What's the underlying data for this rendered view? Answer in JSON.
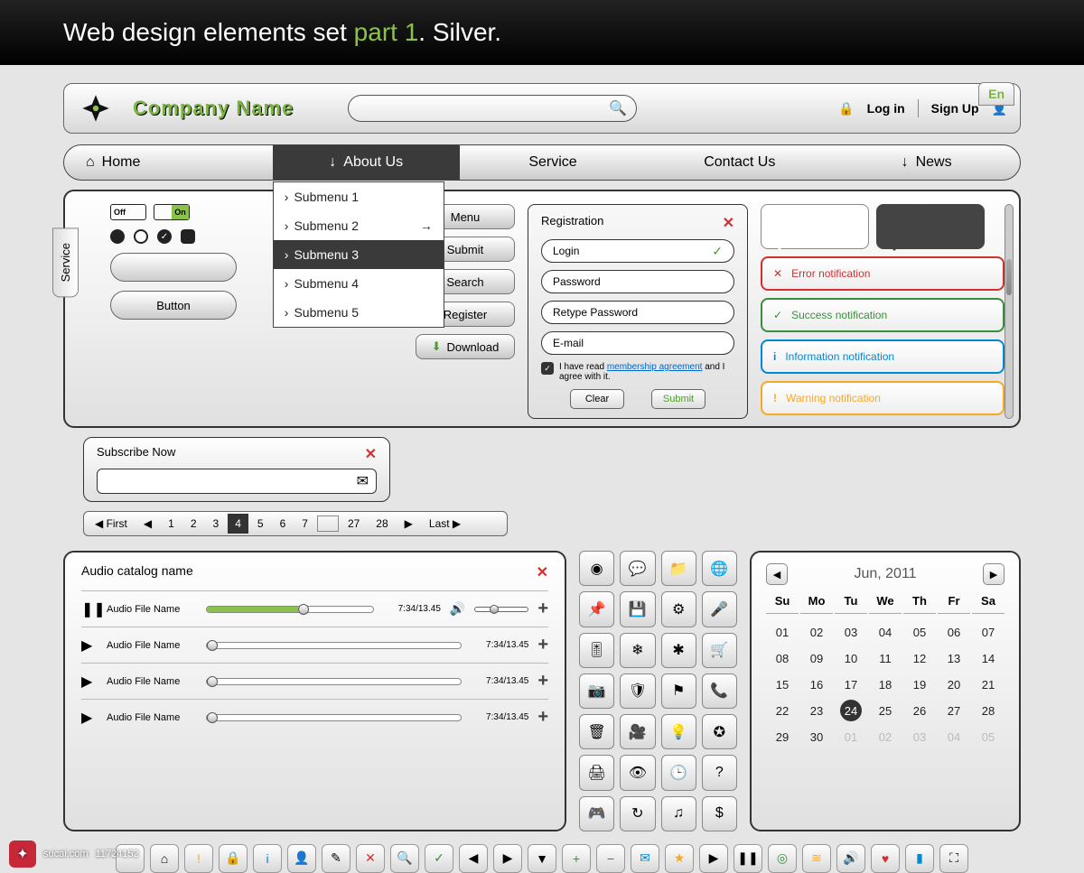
{
  "banner": {
    "pre": "Web design elements set ",
    "accent": "part 1",
    "post": ". Silver."
  },
  "header": {
    "company": "Company Name",
    "lang": "En",
    "login": "Log in",
    "signup": "Sign Up"
  },
  "nav": {
    "items": [
      {
        "label": "Home",
        "icon": "home"
      },
      {
        "label": "About Us",
        "icon": "down"
      },
      {
        "label": "Service"
      },
      {
        "label": "Contact Us"
      },
      {
        "label": "News",
        "icon": "down"
      }
    ],
    "submenu": [
      "Submenu 1",
      "Submenu 2",
      "Submenu 3",
      "Submenu 4",
      "Submenu 5"
    ],
    "submenu_active": 2
  },
  "service_tab": "Service",
  "toggles": {
    "off": "Off",
    "on": "On"
  },
  "button_label": "Button",
  "pill_buttons": [
    "Menu",
    "Submit",
    "Search",
    "Register",
    "Download"
  ],
  "registration": {
    "title": "Registration",
    "fields": [
      "Login",
      "Password",
      "Retype Password",
      "E-mail"
    ],
    "agree_pre": "I have read ",
    "agree_link": "membership agreement",
    "agree_post": " and I agree with it.",
    "clear": "Clear",
    "submit": "Submit"
  },
  "notifications": {
    "error": "Error notification",
    "success": "Success notification",
    "info": "Information notification",
    "warning": "Warning notification"
  },
  "subscribe": {
    "title": "Subscribe Now"
  },
  "pagination": {
    "first": "First",
    "last": "Last",
    "pages": [
      "1",
      "2",
      "3",
      "4",
      "5",
      "6",
      "7"
    ],
    "tail": [
      "27",
      "28"
    ],
    "active": "4"
  },
  "audio": {
    "title": "Audio catalog name",
    "tracks": [
      {
        "name": "Audio File Name",
        "time": "7:34/13.45",
        "playing": true,
        "progress": 55
      },
      {
        "name": "Audio File Name",
        "time": "7:34/13.45",
        "playing": false,
        "progress": 0
      },
      {
        "name": "Audio File Name",
        "time": "7:34/13.45",
        "playing": false,
        "progress": 0
      },
      {
        "name": "Audio File Name",
        "time": "7:34/13.45",
        "playing": false,
        "progress": 0
      }
    ]
  },
  "icon_grid": [
    "disc",
    "chat",
    "folder",
    "globe",
    "pin",
    "save",
    "gear",
    "mic",
    "sliders",
    "snow",
    "asterisk",
    "cart",
    "camera",
    "shield",
    "flag",
    "phone",
    "trash",
    "video",
    "bulb",
    "badge",
    "print",
    "eye",
    "clock",
    "help",
    "gamepad",
    "refresh",
    "music",
    "dollar"
  ],
  "icon_glyphs": {
    "disc": "◉",
    "chat": "💬",
    "folder": "📁",
    "globe": "🌐",
    "pin": "📌",
    "save": "💾",
    "gear": "⚙",
    "mic": "🎤",
    "sliders": "🎚",
    "snow": "❄",
    "asterisk": "✱",
    "cart": "🛒",
    "camera": "📷",
    "shield": "🛡",
    "flag": "⚑",
    "phone": "📞",
    "trash": "🗑",
    "video": "🎥",
    "bulb": "💡",
    "badge": "✪",
    "print": "🖨",
    "eye": "👁",
    "clock": "🕒",
    "help": "?",
    "gamepad": "🎮",
    "refresh": "↻",
    "music": "♫",
    "dollar": "$"
  },
  "calendar": {
    "title": "Jun, 2011",
    "dow": [
      "Su",
      "Mo",
      "Tu",
      "We",
      "Th",
      "Fr",
      "Sa"
    ],
    "weeks": [
      [
        "01",
        "02",
        "03",
        "04",
        "05",
        "06",
        "07"
      ],
      [
        "08",
        "09",
        "10",
        "11",
        "12",
        "13",
        "14"
      ],
      [
        "15",
        "16",
        "17",
        "18",
        "19",
        "20",
        "21"
      ],
      [
        "22",
        "23",
        "24",
        "25",
        "26",
        "27",
        "28"
      ],
      [
        "29",
        "30",
        "01",
        "02",
        "03",
        "04",
        "05"
      ]
    ],
    "today": "24",
    "dim_after": 30
  },
  "bottom_icons": [
    "blank",
    "home",
    "alert",
    "lock",
    "info",
    "user",
    "edit",
    "close",
    "search",
    "check",
    "left",
    "right",
    "down",
    "plus",
    "minus",
    "mail",
    "star",
    "play",
    "pause",
    "target",
    "rss",
    "volume",
    "heart",
    "chart",
    "expand"
  ],
  "bottom_glyphs": {
    "blank": "",
    "home": "⌂",
    "alert": "!",
    "lock": "🔒",
    "info": "i",
    "user": "👤",
    "edit": "✎",
    "close": "✕",
    "search": "🔍",
    "check": "✓",
    "left": "◀",
    "right": "▶",
    "down": "▼",
    "plus": "+",
    "minus": "−",
    "mail": "✉",
    "star": "★",
    "play": "▶",
    "pause": "❚❚",
    "target": "◎",
    "rss": "≋",
    "volume": "🔊",
    "heart": "♥",
    "chart": "▮",
    "expand": "⛶"
  },
  "bottom_colors": {
    "alert": "#f9a825",
    "lock": "#f9a825",
    "info": "#0288d1",
    "user": "#388e3c",
    "close": "#d32f2f",
    "search": "#0288d1",
    "check": "#388e3c",
    "plus": "#388e3c",
    "minus": "#d32f2f",
    "mail": "#0288d1",
    "star": "#f9a825",
    "target": "#388e3c",
    "rss": "#f9a825",
    "heart": "#d32f2f",
    "chart": "#0288d1"
  },
  "watermark": {
    "site": "sucai.com",
    "id": "11724152"
  }
}
